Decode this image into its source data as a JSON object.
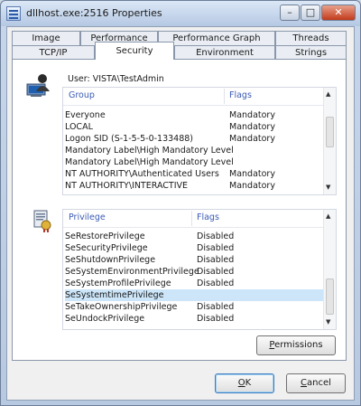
{
  "window": {
    "title": "dllhost.exe:2516 Properties"
  },
  "title_buttons": {
    "minimize": "–",
    "maximize": "□",
    "close": "✕"
  },
  "tabs_row1": [
    "Image",
    "Performance",
    "Performance Graph",
    "Threads"
  ],
  "tabs_row2": [
    "TCP/IP",
    "Security",
    "Environment",
    "Strings"
  ],
  "active_tab": "Security",
  "user": {
    "text": "User:  VISTA\\TestAdmin"
  },
  "groups": {
    "columns": [
      "Group",
      "Flags"
    ],
    "rows": [
      {
        "group": "Everyone",
        "flags": "Mandatory"
      },
      {
        "group": "LOCAL",
        "flags": "Mandatory"
      },
      {
        "group": "Logon SID (S-1-5-5-0-133488)",
        "flags": "Mandatory"
      },
      {
        "group": "Mandatory Label\\High Mandatory Level",
        "flags": ""
      },
      {
        "group": "Mandatory Label\\High Mandatory Level",
        "flags": ""
      },
      {
        "group": "NT AUTHORITY\\Authenticated Users",
        "flags": "Mandatory"
      },
      {
        "group": "NT AUTHORITY\\INTERACTIVE",
        "flags": "Mandatory"
      }
    ]
  },
  "privileges": {
    "columns": [
      "Privilege",
      "Flags"
    ],
    "rows": [
      {
        "privilege": "SeRestorePrivilege",
        "flags": "Disabled"
      },
      {
        "privilege": "SeSecurityPrivilege",
        "flags": "Disabled"
      },
      {
        "privilege": "SeShutdownPrivilege",
        "flags": "Disabled"
      },
      {
        "privilege": "SeSystemEnvironmentPrivilege",
        "flags": "Disabled"
      },
      {
        "privilege": "SeSystemProfilePrivilege",
        "flags": "Disabled"
      },
      {
        "privilege": "SeSystemtimePrivilege",
        "flags": ""
      },
      {
        "privilege": "SeTakeOwnershipPrivilege",
        "flags": "Disabled"
      },
      {
        "privilege": "SeUndockPrivilege",
        "flags": "Disabled"
      }
    ],
    "selected_index": 5
  },
  "buttons": {
    "permissions_mnemonic": "P",
    "permissions_rest": "ermissions",
    "ok_mnemonic": "O",
    "ok_rest": "K",
    "cancel_mnemonic": "C",
    "cancel_rest": "ancel"
  },
  "colors": {
    "header_text": "#3b5bb4",
    "selection": "#cce5f8"
  }
}
